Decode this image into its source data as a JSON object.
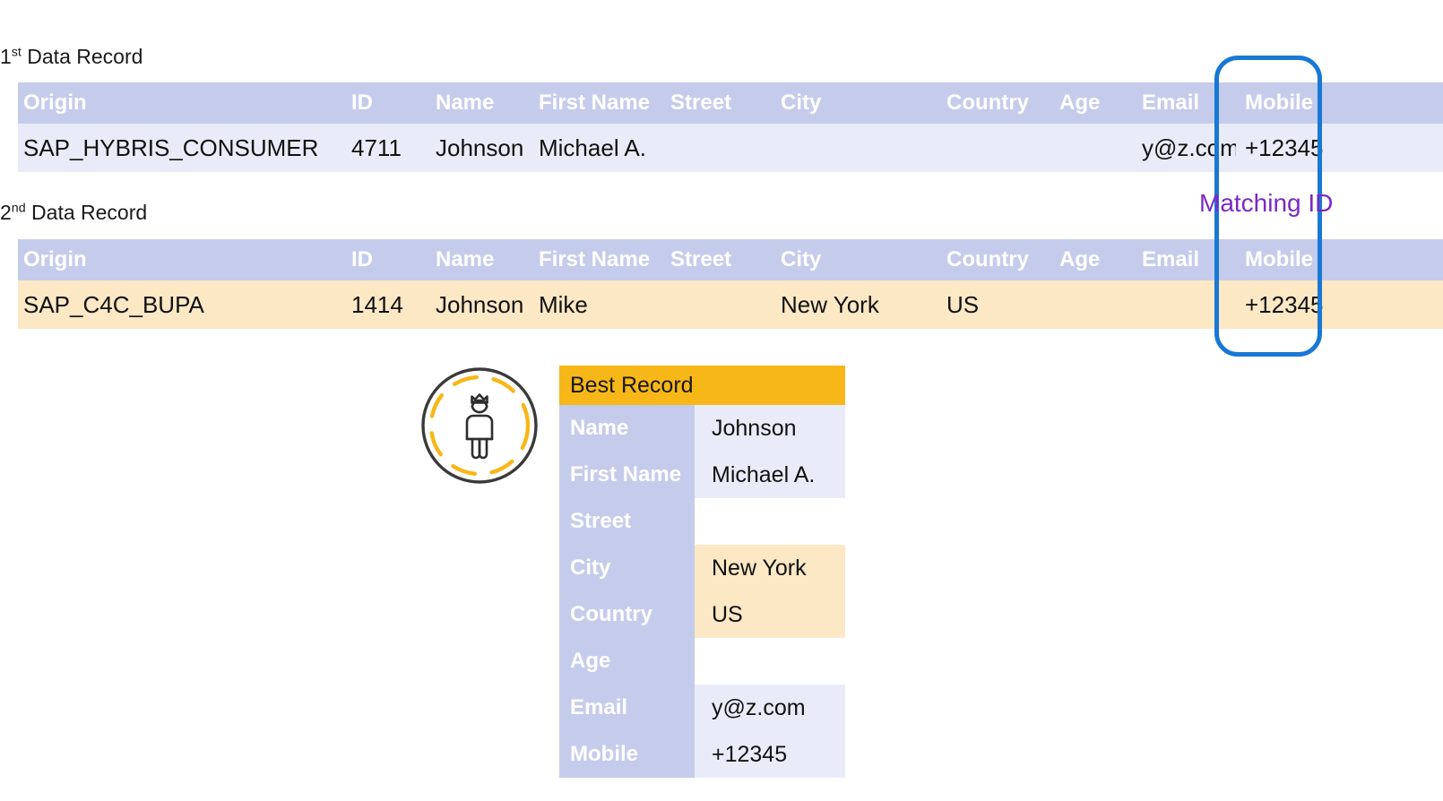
{
  "records": [
    {
      "caption_prefix": "1",
      "caption_sup": "st",
      "caption_suffix": " Data Record",
      "row_tint": "blue",
      "columns": [
        "Origin",
        "ID",
        "Name",
        "First Name",
        "Street",
        "City",
        "Country",
        "Age",
        "Email",
        "Mobile"
      ],
      "values": {
        "origin": "SAP_HYBRIS_CONSUMER",
        "id": "4711",
        "name": "Johnson",
        "first_name": "Michael A.",
        "street": "",
        "city": "",
        "country": "",
        "age": "",
        "email": "y@z.com",
        "mobile": "+12345"
      }
    },
    {
      "caption_prefix": "2",
      "caption_sup": "nd",
      "caption_suffix": " Data Record",
      "row_tint": "peach",
      "columns": [
        "Origin",
        "ID",
        "Name",
        "First Name",
        "Street",
        "City",
        "Country",
        "Age",
        "Email",
        "Mobile"
      ],
      "values": {
        "origin": "SAP_C4C_BUPA",
        "id": "1414",
        "name": "Johnson",
        "first_name": "Mike",
        "street": "",
        "city": "New York",
        "country": "US",
        "age": "",
        "email": "",
        "mobile": "+12345"
      }
    }
  ],
  "annotation": {
    "matching_id_label": "Matching ID",
    "highlight_column": "Mobile",
    "box_color": "#1878d4",
    "label_color": "#7a29c4"
  },
  "badge": {
    "icon": "crowned-person-icon",
    "ring_color": "#f7b718",
    "circle_color": "#3a3a3a"
  },
  "best_record": {
    "title": "Best Record",
    "title_bg": "#f7b718",
    "rows": [
      {
        "label": "Name",
        "value": "Johnson",
        "source": "blue"
      },
      {
        "label": "First Name",
        "value": "Michael A.",
        "source": "blue"
      },
      {
        "label": "Street",
        "value": "",
        "source": "none"
      },
      {
        "label": "City",
        "value": "New York",
        "source": "peach"
      },
      {
        "label": "Country",
        "value": "US",
        "source": "peach"
      },
      {
        "label": "Age",
        "value": "",
        "source": "none"
      },
      {
        "label": "Email",
        "value": "y@z.com",
        "source": "blue"
      },
      {
        "label": "Mobile",
        "value": "+12345",
        "source": "blue"
      }
    ]
  },
  "palette": {
    "header_bg": "#c5cceb",
    "row_blue": "#e9ecf8",
    "row_peach": "#fce8c4",
    "accent_orange": "#f7b718"
  }
}
